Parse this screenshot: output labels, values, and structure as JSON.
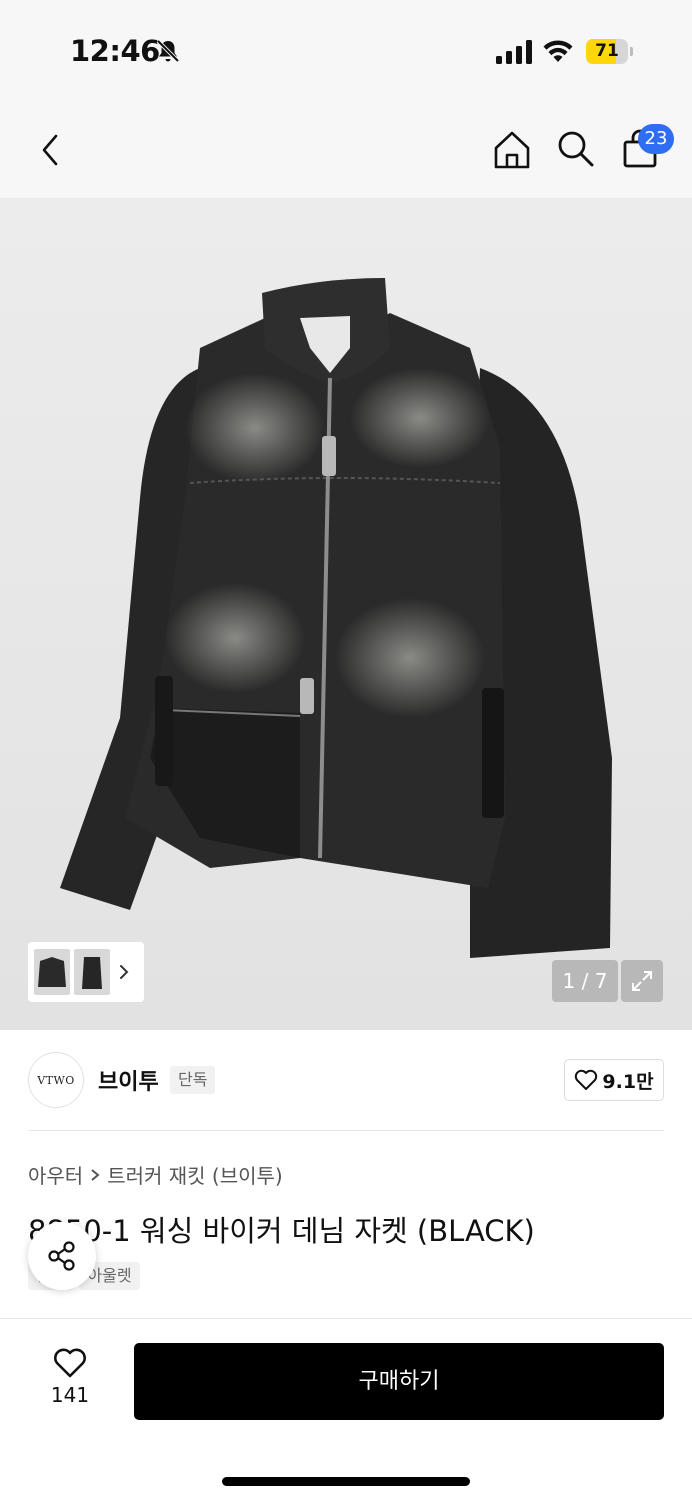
{
  "status_bar": {
    "time": "12:46",
    "battery_level": "71",
    "battery_percent": 71,
    "battery_color": "#ffd60a",
    "icons": [
      "bell-slash-icon",
      "signal-icon",
      "wifi-icon",
      "battery-icon"
    ]
  },
  "nav": {
    "icons": [
      "chevron-left-icon",
      "home-icon",
      "search-icon",
      "shopping-bag-icon"
    ],
    "cart_badge": "23",
    "badge_color": "#2f6ef2"
  },
  "gallery": {
    "page_counter": "1 / 7",
    "thumbnail_count": 3,
    "icons": [
      "chevron-right-icon",
      "expand-icon"
    ]
  },
  "brand": {
    "logo_text": "VTWO",
    "name": "브이투",
    "tag": "단독",
    "likes": "9.1만"
  },
  "product": {
    "breadcrumb": [
      "아우터",
      "트러커 재킷 (브이투)"
    ],
    "title": "8850-1 워싱 바이커 데님 자켓 (BLACK)",
    "tags": [
      "단독",
      "아울렛"
    ]
  },
  "bottom_bar": {
    "wish_count": "141",
    "buy_label": "구매하기"
  }
}
